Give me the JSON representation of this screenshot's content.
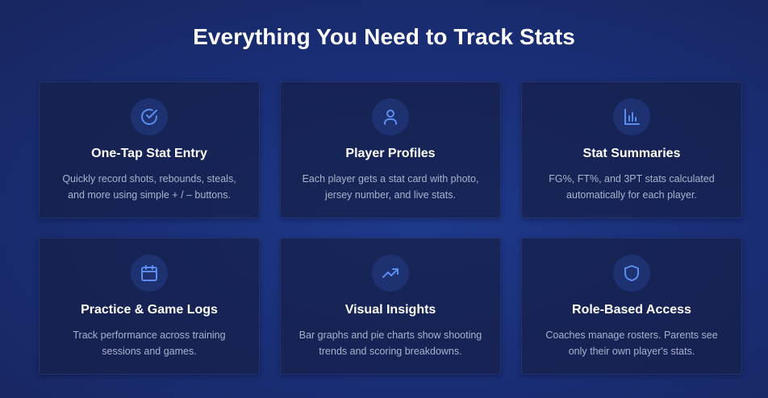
{
  "header": {
    "title": "Everything You Need to Track Stats"
  },
  "features": [
    {
      "icon": "check-circle-icon",
      "title": "One-Tap Stat Entry",
      "desc_line1": "Quickly record shots, rebounds, steals,",
      "desc_line2": "and more using simple + / – buttons."
    },
    {
      "icon": "user-icon",
      "title": "Player Profiles",
      "desc_line1": "Each player gets a stat card with photo,",
      "desc_line2": "jersey number, and live stats."
    },
    {
      "icon": "bar-chart-icon",
      "title": "Stat Summaries",
      "desc_line1": "FG%, FT%, and 3PT stats calculated",
      "desc_line2": "automatically for each player."
    },
    {
      "icon": "calendar-icon",
      "title": "Practice & Game Logs",
      "desc_line1": "Track performance across training",
      "desc_line2": "sessions and games."
    },
    {
      "icon": "trending-up-icon",
      "title": "Visual Insights",
      "desc_line1": "Bar graphs and pie charts show shooting",
      "desc_line2": "trends and scoring breakdowns."
    },
    {
      "icon": "shield-icon",
      "title": "Role-Based Access",
      "desc_line1": "Coaches manage rosters. Parents see",
      "desc_line2": "only their own player's stats."
    }
  ],
  "colors": {
    "accent": "#5b8def",
    "icon_bg": "#1e3170",
    "card_bg": "#16204a",
    "desc_text": "#a9b3cc"
  }
}
